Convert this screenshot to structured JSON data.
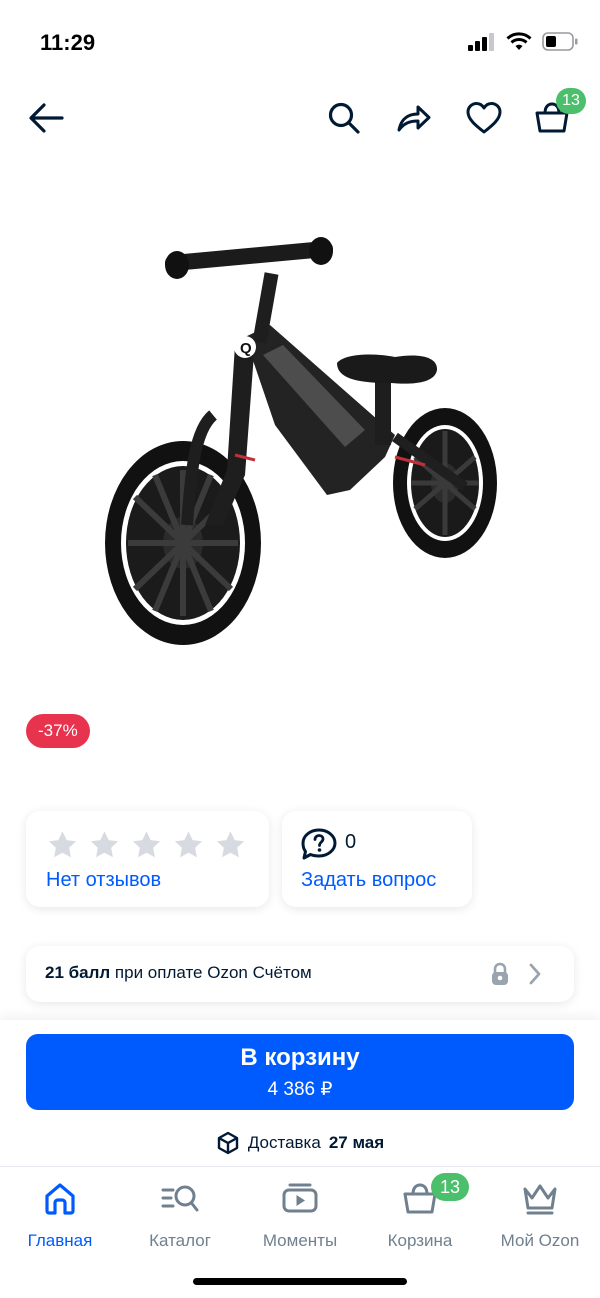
{
  "status_bar": {
    "time": "11:29",
    "icons": [
      "signal-icon",
      "wifi-icon",
      "battery-icon"
    ]
  },
  "top_nav": {
    "icons": [
      "back-arrow-icon",
      "search-icon",
      "share-icon",
      "heart-icon",
      "cart-icon"
    ],
    "cart_count": "13"
  },
  "product": {
    "image": "black-balance-bike-racer",
    "discount": "-37%"
  },
  "reviews": {
    "rating_stars": 0,
    "max_stars": 5,
    "label": "Нет отзывов"
  },
  "questions": {
    "count": "0",
    "label": "Задать вопрос"
  },
  "points": {
    "bold": "21 балл",
    "text": " при оплате Ozon Счётом"
  },
  "buy": {
    "label": "В корзину",
    "price": "4 386 ₽"
  },
  "delivery": {
    "label": "Доставка",
    "date": "27 мая"
  },
  "tabs": [
    {
      "label": "Главная",
      "icon": "home-icon",
      "active": true
    },
    {
      "label": "Каталог",
      "icon": "catalog-search-icon"
    },
    {
      "label": "Моменты",
      "icon": "moments-play-icon"
    },
    {
      "label": "Корзина",
      "icon": "cart-icon",
      "badge": "13"
    },
    {
      "label": "Мой Ozon",
      "icon": "crown-icon"
    }
  ],
  "colors": {
    "accent": "#005bff",
    "badge_green": "#4bbf6b",
    "discount_red": "#e8334e",
    "text_dark": "#001a34",
    "text_gray": "#70808f",
    "star_gray": "#d7dbe1"
  }
}
